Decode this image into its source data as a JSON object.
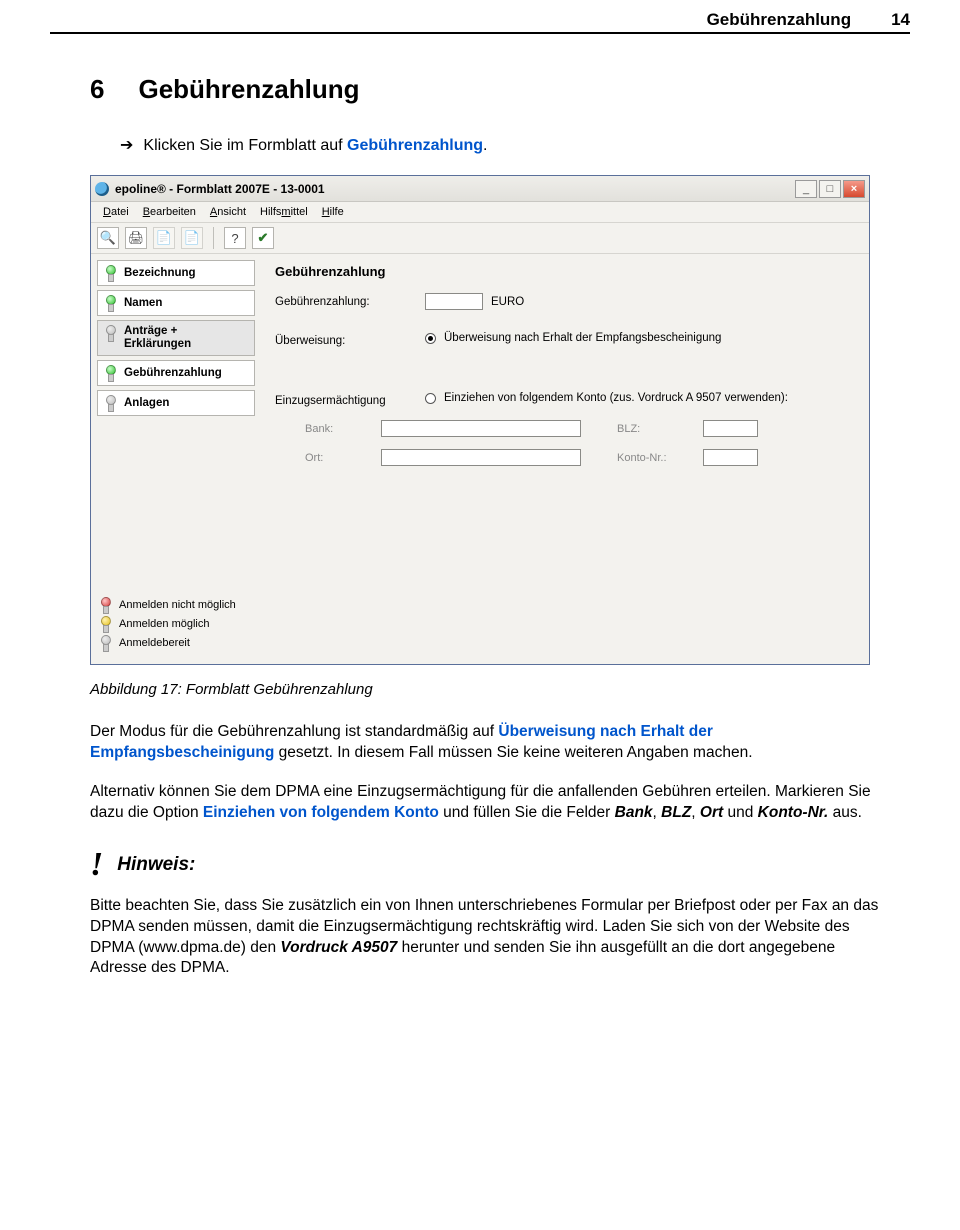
{
  "header": {
    "label": "Gebührenzahlung",
    "page": "14"
  },
  "section": {
    "num": "6",
    "title": "Gebührenzahlung"
  },
  "instruction": {
    "arrow": "➔",
    "pre": "Klicken Sie im Formblatt auf ",
    "link": "Gebührenzahlung",
    "post": "."
  },
  "window": {
    "title": "epoline® - Formblatt 2007E - 13-0001",
    "btn_min": "_",
    "btn_max": "□",
    "btn_close": "×",
    "menu": {
      "m1": "Datei",
      "m2": "Bearbeiten",
      "m3": "Ansicht",
      "m4": "Hilfsmittel",
      "m5": "Hilfe"
    },
    "sidebar": {
      "s1": "Bezeichnung",
      "s2": "Namen",
      "s3a": "Anträge +",
      "s3b": "Erklärungen",
      "s4": "Gebührenzahlung",
      "s5": "Anlagen"
    },
    "legend": {
      "l1": "Anmelden nicht möglich",
      "l2": "Anmelden möglich",
      "l3": "Anmeldebereit"
    },
    "content": {
      "heading": "Gebührenzahlung",
      "fee_label": "Gebührenzahlung:",
      "fee_unit": "EURO",
      "transfer_label": "Überweisung:",
      "transfer_opt": "Überweisung nach Erhalt der Empfangsbescheinigung",
      "debit_label": "Einzugsermächtigung",
      "debit_opt": "Einziehen von folgendem Konto (zus. Vordruck A 9507 verwenden):",
      "bank": "Bank:",
      "blz": "BLZ:",
      "ort": "Ort:",
      "konto": "Konto-Nr.:"
    }
  },
  "caption": "Abbildung 17: Formblatt Gebührenzahlung",
  "para1": {
    "t1": "Der Modus für die Gebührenzahlung ist standardmäßig auf ",
    "link1": "Überweisung nach Erhalt der Empfangsbescheinigung",
    "t2": " gesetzt. In diesem Fall müssen Sie keine weiteren Angaben machen."
  },
  "para2": {
    "t1": "Alternativ können Sie dem DPMA eine Einzugsermächtigung für die anfallenden Gebühren erteilen. Markieren Sie dazu die Option ",
    "link1": "Einziehen von folgendem Konto",
    "t2": " und füllen Sie die Felder ",
    "f1": "Bank",
    "c1": ", ",
    "f2": "BLZ",
    "c2": ", ",
    "f3": "Ort",
    "c3": " und ",
    "f4": "Konto-Nr.",
    "t3": " aus."
  },
  "hinweis": {
    "bang": "!",
    "label": "Hinweis:"
  },
  "para3": {
    "t1": "Bitte beachten Sie, dass Sie zusätzlich ein von Ihnen unterschriebenes Formular per Briefpost oder per Fax an das DPMA senden müssen, damit die Einzugsermächtigung rechtskräftig wird. Laden Sie sich von der Website des DPMA (www.dpma.de) den ",
    "f1": "Vordruck A9507",
    "t2": " herunter und senden Sie ihn ausgefüllt an die dort angegebene Adresse des DPMA."
  }
}
